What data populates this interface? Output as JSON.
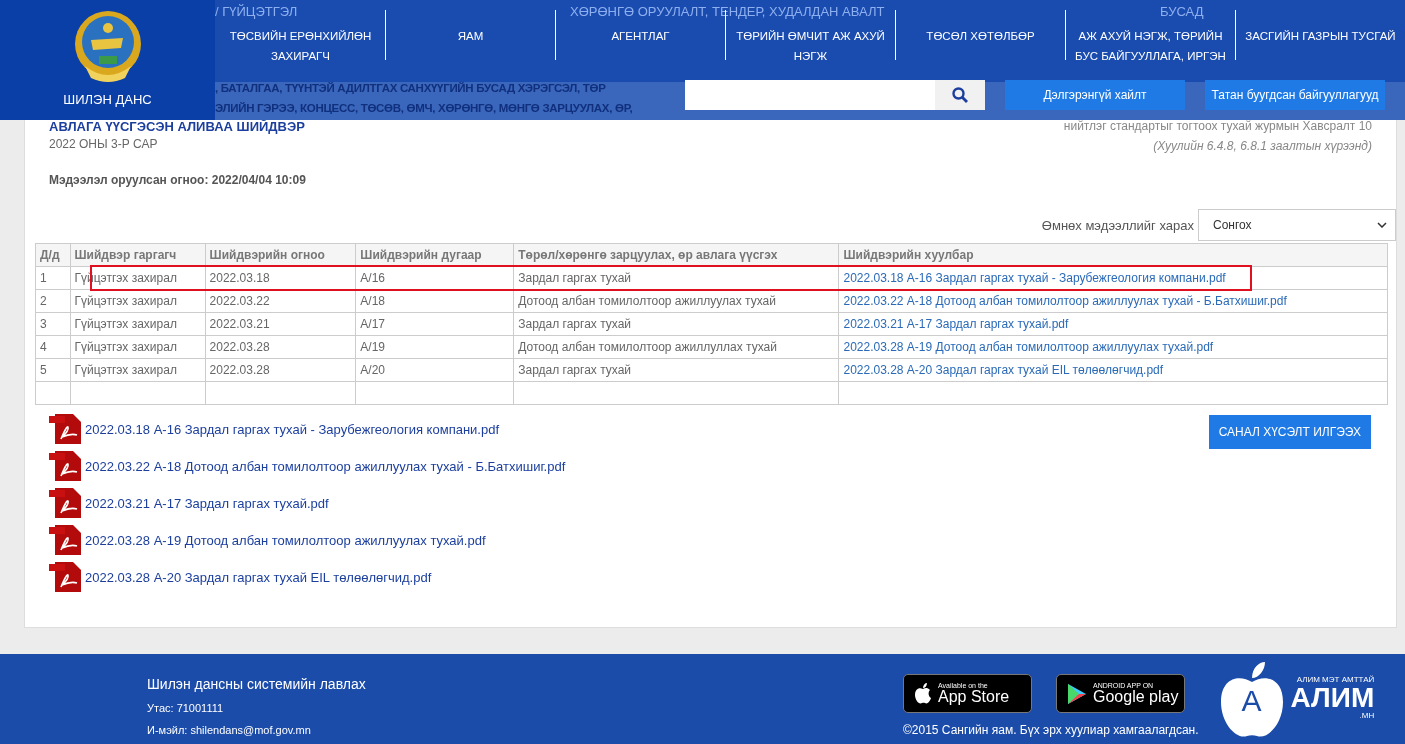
{
  "header": {
    "logo_text": "ШИЛЭН ДАНС",
    "menu_strip": [
      "/ ГҮЙЦЭТГЭЛ",
      "ХӨРӨНГӨ ОРУУЛАЛТ, ТЕНДЕР, ХУДАЛДАН АВАЛТ",
      "БУСАД"
    ],
    "nav": [
      "ТӨСВИЙН ЕРӨНХИЙЛӨН ЗАХИРАГЧ",
      "ЯАМ",
      "АГЕНТЛАГ",
      "ТӨРИЙН ӨМЧИТ АЖ АХУЙ НЭГЖ",
      "ТӨСӨЛ ХӨТӨЛБӨР",
      "АЖ АХУЙ НЭГЖ, ТӨРИЙН БУС БАЙГУУЛЛАГА, ИРГЭН",
      "ЗАСГИЙН ГАЗРЫН ТУСГАЙ"
    ],
    "title_fragments": [
      ", БАТАЛГАА, ТҮҮНТЭЙ АДИЛТГАХ САНХҮҮГИЙН БУСАД ХЭРЭГСЭЛ, ТӨР",
      "ЭЛИЙН ГЭРЭЭ, КОНЦЕСС, ТӨСӨВ, ӨМЧ, ХӨРӨНГӨ, МӨНГӨ ЗАРЦУУЛАХ, ӨР,"
    ],
    "buttons": [
      "Дэлгэрэнгүй хайлт",
      "Татан буугдсан байгууллагууд"
    ]
  },
  "page": {
    "title": "АВЛАГА ҮҮСГЭСЭН АЛИВАА ШИЙДВЭР",
    "period": "2022 ОНЫ 3-Р САР",
    "standard_note": "нийтлэг стандартыг тогтоох тухай журмын Хавсралт 10",
    "law_note": "(Хуулийн 6.4.8, 6.8.1 заалтын хүрээнд)",
    "entry_date": "Мэдээлэл оруулсан огноо: 2022/04/04 10:09"
  },
  "history": {
    "label": "Өмнөх мэдээллийг харах",
    "value": "Сонгох"
  },
  "table": {
    "columns": [
      "Д/д",
      "Шийдвэр гаргагч",
      "Шийдвэрийн огноо",
      "Шийдвэрийн дугаар",
      "Төрөл/хөрөнгө зарцуулах, өр авлага үүсгэх",
      "Шийдвэрийн хуулбар"
    ],
    "rows": [
      {
        "cells": [
          "1",
          "Гүйцэтгэх захирал",
          "2022.03.18",
          "А/16",
          "Зардал гаргах тухай"
        ],
        "file": "2022.03.18 А-16 Зардал гаргах тухай - Зарубежгеология компани.pdf",
        "highlighted": true
      },
      {
        "cells": [
          "2",
          "Гүйцэтгэх захирал",
          "2022.03.22",
          "А/18",
          "Дотоод албан томилолтоор ажиллуулах тухай"
        ],
        "file": "2022.03.22 А-18 Дотоод албан томилолтоор ажиллуулах тухай - Б.Батхишиг.pdf",
        "highlighted": false
      },
      {
        "cells": [
          "3",
          "Гүйцэтгэх захирал",
          "2022.03.21",
          "А/17",
          "Зардал гаргах тухай"
        ],
        "file": "2022.03.21 А-17 Зардал гаргах тухай.pdf",
        "highlighted": false
      },
      {
        "cells": [
          "4",
          "Гүйцэтгэх захирал",
          "2022.03.28",
          "А/19",
          "Дотоод албан томилолтоор ажиллуллах тухай"
        ],
        "file": "2022.03.28 А-19 Дотоод албан томилолтоор ажиллуулах тухай.pdf",
        "highlighted": false
      },
      {
        "cells": [
          "5",
          "Гүйцэтгэх захирал",
          "2022.03.28",
          "А/20",
          "Зардал гаргах тухай"
        ],
        "file": "2022.03.28 А-20 Зардал гаргах тухай EIL төлөөлөгчид.pdf",
        "highlighted": false
      }
    ]
  },
  "attachments": [
    "2022.03.18 А-16 Зардал гаргах тухай - Зарубежгеология компани.pdf",
    "2022.03.22 А-18 Дотоод албан томилолтоор ажиллуулах тухай - Б.Батхишиг.pdf",
    "2022.03.21 А-17 Зардал гаргах тухай.pdf",
    "2022.03.28 А-19 Дотоод албан томилолтоор ажиллуулах тухай.pdf",
    "2022.03.28 А-20 Зардал гаргах тухай EIL төлөөлөгчид.pdf"
  ],
  "feedback_button": "САНАЛ ХҮСЭЛТ ИЛГЭЭХ",
  "footer": {
    "title": "Шилэн дансны системийн лавлах",
    "phone": "Утас: 71001111",
    "email": "И-мэйл: shilendans@mof.gov.mn",
    "app_store": {
      "small": "Available on the",
      "big": "App Store"
    },
    "google_play": {
      "small": "ANDROID APP ON",
      "big": "Google play"
    },
    "copyright": "©2015 Сангийн яам. Бүх эрх хуулиар хамгаалагдсан.",
    "alim": {
      "letter": "A",
      "tagline": "АЛИМ МЭТ АМТТАЙ",
      "name": "АЛИМ",
      "domain": ".МН"
    }
  }
}
